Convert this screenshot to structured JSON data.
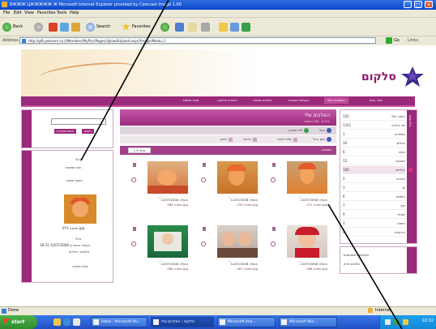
{
  "window": {
    "title": "ВЖЖЖ ЦЖЖЖЖЖ Ж Microsoft Internet Explorer provided by Comcast Image 1.00",
    "controls": {
      "min": "_",
      "max": "□",
      "close": "×"
    }
  },
  "menu": [
    "File",
    "Edit",
    "View",
    "Favorites",
    "Tools",
    "Help"
  ],
  "toolbar": {
    "back": "Back",
    "search": "Search",
    "favorites": "Favorites"
  },
  "address": {
    "label": "Address",
    "url": "http://gift.pelecom.co.il/Members/MyPics/Pages/Upload/Upload.aspx?ImagesMode=1",
    "go": "Go",
    "links": "Links"
  },
  "site": {
    "logo": "סלקום",
    "nav": [
      "אזור אישי",
      "התמונות שלי",
      "העלאת תמונות",
      "שליחת תמונה",
      "הזמנת הדפסה",
      "תנאי שימוש"
    ]
  },
  "right_panel": {
    "tab": "אלבומים",
    "rows": [
      {
        "num": "120",
        "name": "השנה שלי"
      },
      {
        "num": "1321",
        "name": "ימי הולדת"
      },
      {
        "num": "1",
        "name": "משפחה"
      },
      {
        "num": "16",
        "name": "טיולים"
      },
      {
        "num": "6",
        "name": "חגים"
      },
      {
        "num": "13",
        "name": "תמונות"
      },
      {
        "num": "106",
        "name": "הילדים"
      },
      {
        "num": "2",
        "name": "חברים"
      },
      {
        "num": "3",
        "name": "ים"
      },
      {
        "num": "6",
        "name": "חופשה"
      },
      {
        "num": "7",
        "name": "קיץ"
      },
      {
        "num": "9",
        "name": "שונות"
      },
      {
        "num": "1",
        "name": "חתונה"
      },
      {
        "num": "4",
        "name": "אירועים"
      }
    ]
  },
  "right_panel2": {
    "line1": "אלבומים משותפים",
    "line2": "אלבום חדש"
  },
  "left_search": {
    "tab": "חיפוש",
    "btn1": "חיפוש",
    "btn2": "חיפוש מתקדם"
  },
  "left_panel": {
    "tab": "פרטים",
    "line1": "הכל",
    "line2": "הצג תמונות",
    "line3": "הוסף תמונה",
    "caption": "תמונה 071.jpg",
    "meta1": "גודל",
    "meta2": "הועלה בתאריך 12/07/2008 18:31",
    "meta3": "אלבום: הילדים",
    "action": "שלח תמונה"
  },
  "main": {
    "title": "האלבום שלי",
    "subtitle": "הילדים - 106 תמונות",
    "nav1": [
      "הכל",
      "לפי תאריך"
    ],
    "nav2": [
      "סמן הכל",
      "שלח לחבר",
      "הדפס",
      "מחק"
    ],
    "pager_label": "תמונות",
    "pager_value": "1 מתוך 9",
    "cards": [
      {
        "cap1": "הועלה 12/07/2008",
        "cap2": "תמונה 071.jpg"
      },
      {
        "cap1": "הועלה 12/07/2008",
        "cap2": "תמונה 070.jpg"
      },
      {
        "cap1": "הועלה 12/07/2008",
        "cap2": "תמונה 069.jpg"
      },
      {
        "cap1": "הועלה 12/07/2008",
        "cap2": "תמונה 068.jpg"
      },
      {
        "cap1": "הועלה 12/07/2008",
        "cap2": "תמונה 067.jpg"
      },
      {
        "cap1": "הועלה 12/07/2008",
        "cap2": "תמונה 066.jpg"
      }
    ]
  },
  "status": {
    "left": "Done",
    "right": "Internet"
  },
  "taskbar": {
    "start": "start",
    "tasks": [
      "Inbox - Microsoft Ou...",
      "סלקום - האלבום שלי",
      "Microsoft Ima...",
      "Microsoft Wor..."
    ],
    "clock": "10:32"
  },
  "colors": {
    "brand": "#9b2a7c",
    "accent": "#c24a9a",
    "xp_blue": "#1f4fc4"
  }
}
